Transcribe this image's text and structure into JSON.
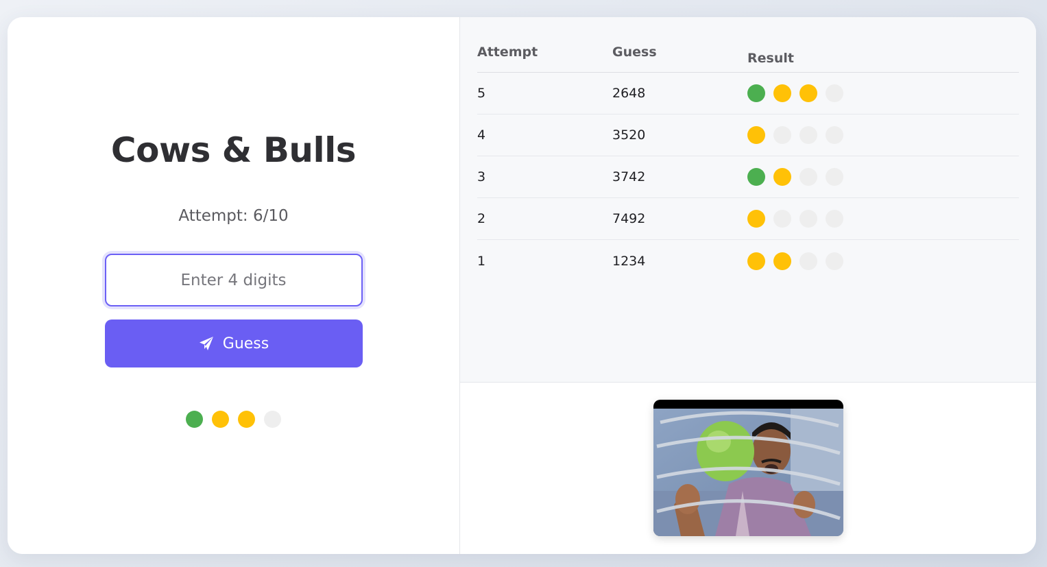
{
  "game": {
    "title": "Cows & Bulls",
    "attempt_label": "Attempt: 6/10",
    "input_placeholder": "Enter 4 digits",
    "guess_button_label": "Guess",
    "guess_button_icon": "paper-plane-icon",
    "current_result": [
      "bull",
      "cow",
      "cow",
      "none"
    ]
  },
  "colors": {
    "bull": "#4caf50",
    "cow": "#ffc107",
    "none": "#eeeeee",
    "accent": "#6a5ef3"
  },
  "history": {
    "headers": {
      "attempt": "Attempt",
      "guess": "Guess",
      "result": "Result"
    },
    "rows": [
      {
        "attempt": "5",
        "guess": "2648",
        "result": [
          "bull",
          "cow",
          "cow",
          "none"
        ]
      },
      {
        "attempt": "4",
        "guess": "3520",
        "result": [
          "cow",
          "none",
          "none",
          "none"
        ]
      },
      {
        "attempt": "3",
        "guess": "3742",
        "result": [
          "bull",
          "cow",
          "none",
          "none"
        ]
      },
      {
        "attempt": "2",
        "guess": "7492",
        "result": [
          "cow",
          "none",
          "none",
          "none"
        ]
      },
      {
        "attempt": "1",
        "guess": "1234",
        "result": [
          "cow",
          "cow",
          "none",
          "none"
        ]
      }
    ]
  },
  "media": {
    "meme_image": "reaction-meme-image"
  }
}
